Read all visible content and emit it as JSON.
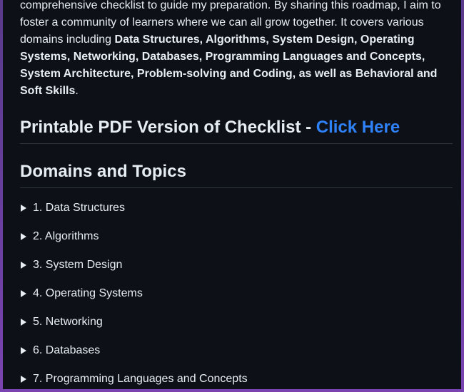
{
  "intro": {
    "t1": "comprehensive checklist to guide my preparation. By sharing this roadmap, I aim to foster a community of learners where we can all grow together. It covers various domains including ",
    "bold": "Data Structures, Algorithms, System Design, Operating Systems, Networking, Databases, Programming Languages and Concepts, System Architecture, Problem-solving and Coding, as well as Behavioral and Soft Skills",
    "t2": "."
  },
  "pdf": {
    "heading_text": "Printable PDF Version of Checklist - ",
    "link_text": "Click Here"
  },
  "domains": {
    "heading": "Domains and Topics",
    "items": [
      "1. Data Structures",
      "2. Algorithms",
      "3. System Design",
      "4. Operating Systems",
      "5. Networking",
      "6. Databases",
      "7. Programming Languages and Concepts"
    ]
  },
  "colors": {
    "background": "#0d1117",
    "text": "#e6edf3",
    "link": "#2f81f7",
    "divider": "#30363d"
  },
  "icons": {
    "disclosure": "triangle-right-icon"
  }
}
